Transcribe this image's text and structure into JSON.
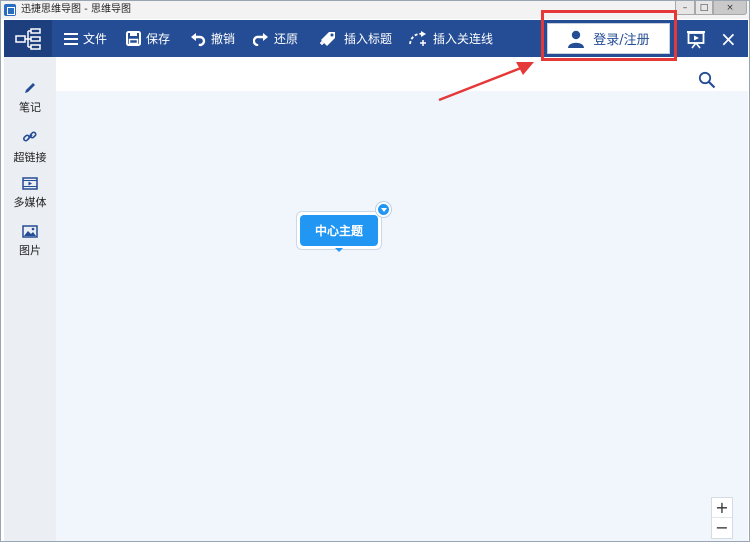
{
  "window": {
    "title": "迅捷思维导图 - 思维导图",
    "controls": {
      "minimize": "–",
      "maximize": "□",
      "close": "×"
    }
  },
  "toolbar": {
    "file_label": "文件",
    "save_label": "保存",
    "undo_label": "撤销",
    "redo_label": "还原",
    "insert_title_label": "插入标题",
    "insert_link_label": "插入关连线",
    "login_label": "登录/注册",
    "close_symbol": "×"
  },
  "sidebar": {
    "items": [
      {
        "label": "笔记",
        "icon": "pencil-icon"
      },
      {
        "label": "超链接",
        "icon": "link-icon"
      },
      {
        "label": "多媒体",
        "icon": "film-icon"
      },
      {
        "label": "图片",
        "icon": "image-icon"
      }
    ]
  },
  "canvas": {
    "center_topic": "中心主题",
    "zoom_in_symbol": "+",
    "zoom_out_symbol": "−"
  },
  "colors": {
    "toolbar_bg": "#254d95",
    "node_blue": "#2196f3",
    "highlight_red": "#e53838",
    "canvas_bg": "#f1f5fc"
  }
}
